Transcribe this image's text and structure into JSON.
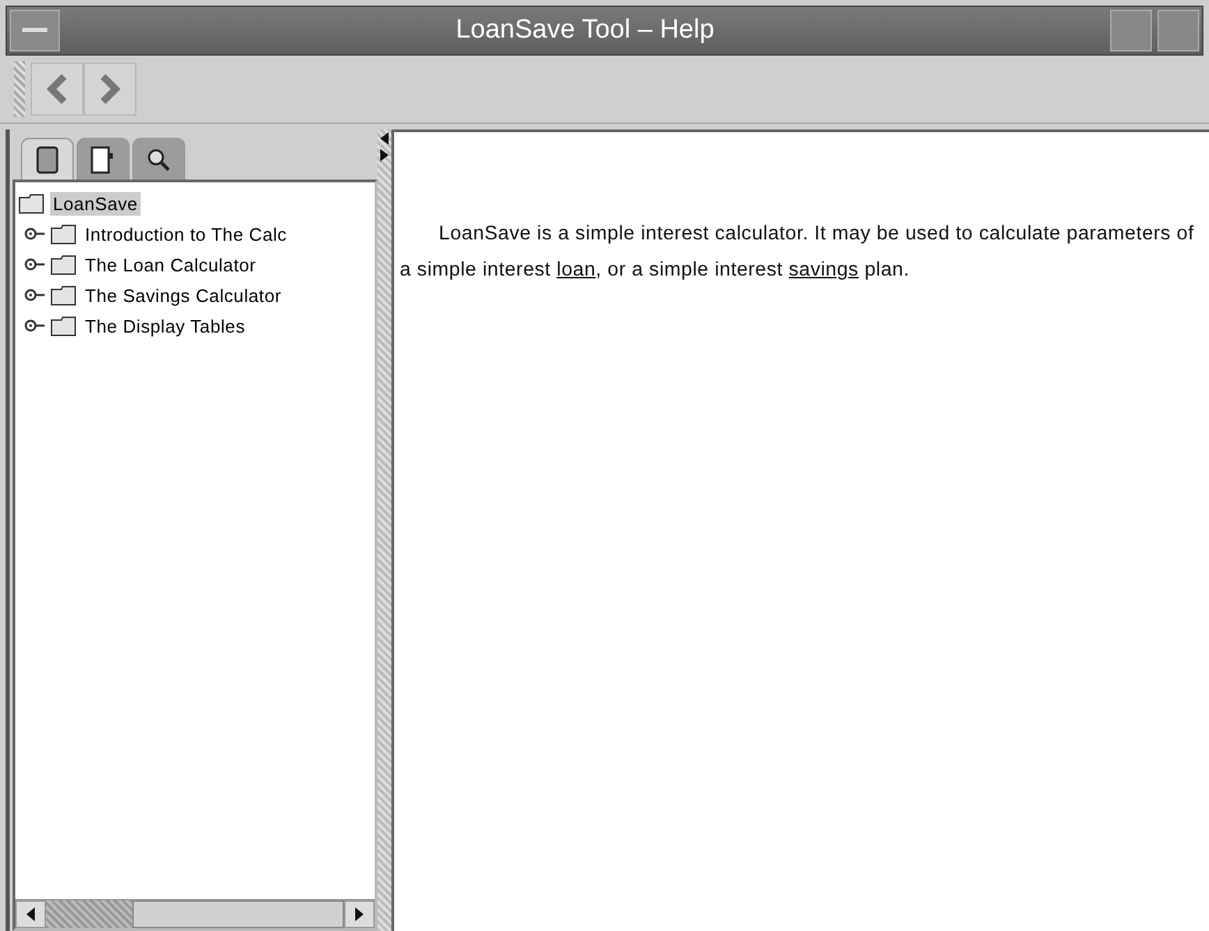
{
  "window": {
    "title": "LoanSave Tool – Help"
  },
  "toolbar": {
    "back_enabled": true,
    "forward_enabled": true
  },
  "nav_tabs": [
    {
      "kind": "contents",
      "selected": true
    },
    {
      "kind": "index",
      "selected": false
    },
    {
      "kind": "search",
      "selected": false
    }
  ],
  "tree": {
    "label": "LoanSave",
    "selected": true,
    "children": [
      {
        "label": "Introduction to The Calc",
        "expanded": false,
        "selected": false
      },
      {
        "label": "The Loan Calculator",
        "expanded": false,
        "selected": false
      },
      {
        "label": "The Savings Calculator",
        "expanded": false,
        "selected": false
      },
      {
        "label": "The Display Tables",
        "expanded": false,
        "selected": false
      }
    ]
  },
  "content": {
    "paragraph": [
      {
        "kind": "text",
        "text": "LoanSave is a simple interest calculator. It may be used to calculate parameters of a simple interest "
      },
      {
        "kind": "link",
        "text": "loan"
      },
      {
        "kind": "text",
        "text": ", or a simple interest "
      },
      {
        "kind": "link",
        "text": "savings"
      },
      {
        "kind": "text",
        "text": " plan."
      }
    ]
  }
}
